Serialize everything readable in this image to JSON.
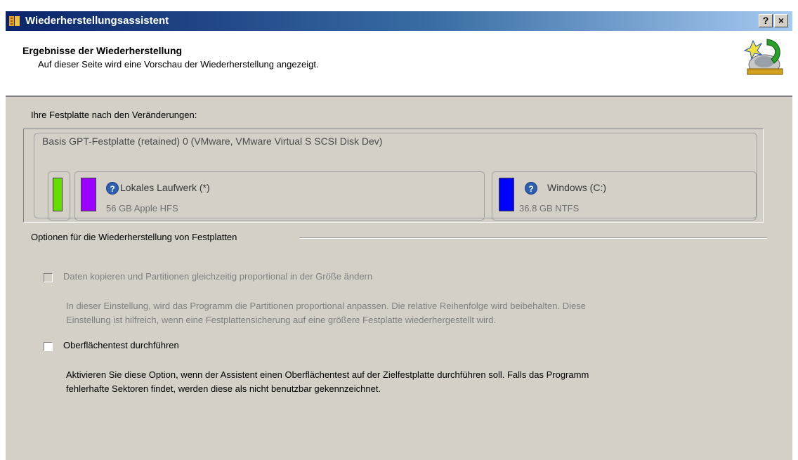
{
  "window": {
    "title": "Wiederherstellungsassistent",
    "help_button": "?",
    "close_button": "×"
  },
  "header": {
    "title": "Ergebnisse der Wiederherstellung",
    "subtitle": "Auf dieser Seite wird eine Vorschau der Wiederherstellung angezeigt."
  },
  "disk_section": {
    "label": "Ihre Festplatte nach den Veränderungen:",
    "disk_title": "Basis GPT-Festplatte (retained) 0 (VMware, VMware Virtual S SCSI Disk Dev)",
    "partitions": [
      {
        "name": "",
        "info": "",
        "color": "#66dd00"
      },
      {
        "name": "Lokales Laufwerk (*)",
        "info": "56 GB Apple HFS",
        "color": "#9900ff"
      },
      {
        "name": "Windows (C:)",
        "info": "36.8 GB NTFS",
        "color": "#0000ff"
      }
    ]
  },
  "options": {
    "group_label": "Optionen für die Wiederherstellung von Festplatten",
    "option1": {
      "label": "Daten kopieren und Partitionen gleichzeitig proportional in der Größe ändern",
      "desc1": "In dieser Einstellung, wird das Programm die Partitionen proportional anpassen. Die relative Reihenfolge wird beibehalten. Diese",
      "desc2": "Einstellung ist hilfreich, wenn eine Festplattensicherung auf eine größere Festplatte wiederhergestellt wird."
    },
    "option2": {
      "label": "Oberflächentest durchführen",
      "desc1": "Aktivieren Sie diese Option, wenn der Assistent einen Oberflächentest auf der Zielfestplatte durchführen soll. Falls das Programm",
      "desc2": "fehlerhafte Sektoren findet, werden diese als nicht benutzbar gekennzeichnet."
    }
  }
}
